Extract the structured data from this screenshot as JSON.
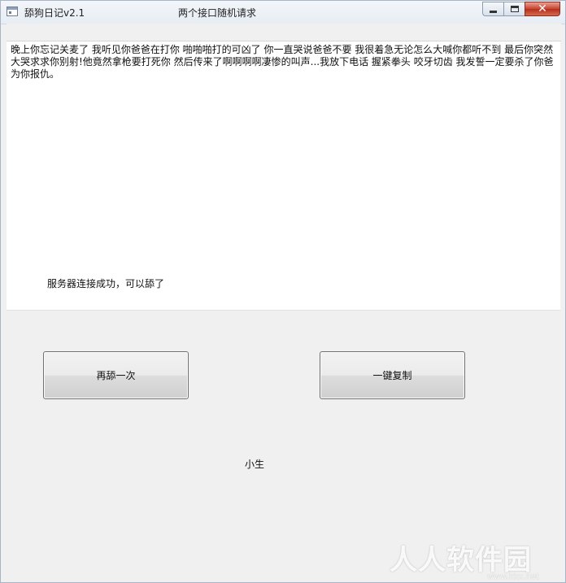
{
  "window": {
    "title": "舔狗日记v2.1",
    "subtitle": "两个接口随机请求",
    "controls": {
      "minimize_icon": "minimize-icon",
      "maximize_icon": "maximize-icon",
      "close_icon": "close-icon",
      "close_glyph": "✕"
    }
  },
  "content": {
    "text": "晚上你忘记关麦了 我听见你爸爸在打你 啪啪啪打的可凶了 你一直哭说爸爸不要 我很着急无论怎么大喊你都听不到 最后你突然大哭求求你别射!他竟然拿枪要打死你 然后传来了啊啊啊啊凄惨的叫声...我放下电话 握紧拳头 咬牙切齿 我发誓一定要杀了你爸 为你报仇。",
    "status": "服务器连接成功，可以舔了"
  },
  "buttons": {
    "again_label": "再舔一次",
    "copy_label": "一键复制"
  },
  "footer": {
    "author": "小生"
  },
  "watermark": {
    "text": "人人软件园",
    "url": "www.kkx.net"
  },
  "colors": {
    "window_bg": "#f0f0f0",
    "content_bg": "#ffffff",
    "close_button": "#c7432f"
  }
}
